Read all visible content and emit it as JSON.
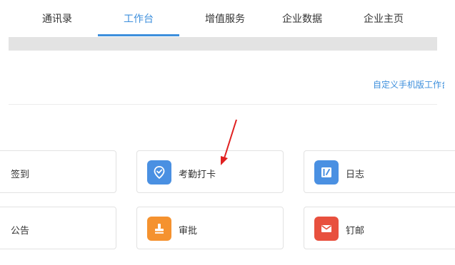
{
  "nav": {
    "tabs": [
      {
        "label": "通讯录"
      },
      {
        "label": "工作台"
      },
      {
        "label": "增值服务"
      },
      {
        "label": "企业数据"
      },
      {
        "label": "企业主页"
      }
    ],
    "active_tab": "工作台"
  },
  "workbench": {
    "customize_link": "自定义手机版工作台",
    "apps": [
      {
        "label": "签到"
      },
      {
        "label": "考勤打卡",
        "icon": "location-check-icon",
        "color": "#4a90e2"
      },
      {
        "label": "日志",
        "icon": "journal-icon",
        "color": "#4a90e2"
      },
      {
        "label": "公告"
      },
      {
        "label": "审批",
        "icon": "approval-stamp-icon",
        "color": "#f5922f"
      },
      {
        "label": "钉邮",
        "icon": "mail-icon",
        "color": "#e8503e"
      }
    ]
  },
  "annotation": {
    "color": "#e02020",
    "points_to": "考勤打卡"
  }
}
